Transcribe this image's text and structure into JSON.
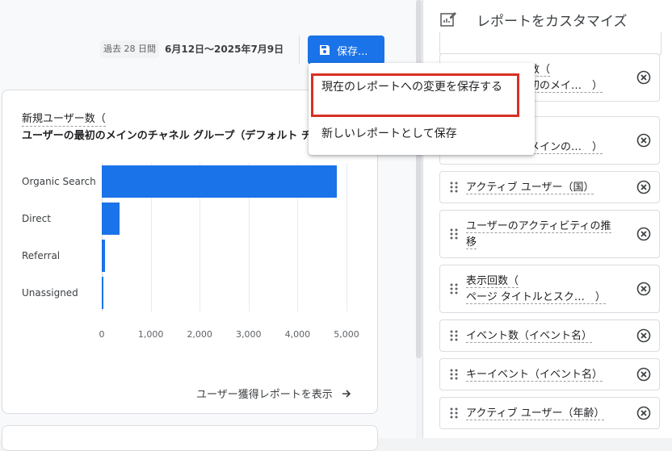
{
  "header": {
    "date_range_label": "過去 28 日間",
    "date_range_value": "6月12日〜2025年7月9日",
    "save_button_label": "保存..."
  },
  "save_menu": {
    "items": [
      {
        "label": "現在のレポートへの変更を保存する"
      },
      {
        "label": "新しいレポートとして保存"
      }
    ]
  },
  "card": {
    "title_line1": "新規ユーザー数（",
    "title_line2": "ユーザーの最初のメインのチャネル グループ（デフォルト チャネル グループ））",
    "view_link": "ユーザー獲得レポートを表示"
  },
  "chart_data": {
    "type": "bar",
    "orientation": "horizontal",
    "categories": [
      "Organic Search",
      "Direct",
      "Referral",
      "Unassigned"
    ],
    "values": [
      4800,
      370,
      70,
      20
    ],
    "xlim": [
      0,
      5000
    ],
    "ticks": [
      "0",
      "1,000",
      "2,000",
      "3,000",
      "4,000",
      "5,000"
    ],
    "color": "#1a73e8"
  },
  "panel": {
    "title": "レポートをカスタマイズ",
    "items": [
      {
        "line1": "数（",
        "line2": "初のメイ…　）"
      },
      {
        "line1": "",
        "line2": "メインの…　）"
      },
      {
        "line1": "アクティブ ユーザー（国）",
        "line2": ""
      },
      {
        "line1": "ユーザーのアクティビティの推",
        "line2": "移"
      },
      {
        "line1": "表示回数（",
        "line2": "ページ タイトルとスク…　）"
      },
      {
        "line1": "イベント数（イベント名）",
        "line2": ""
      },
      {
        "line1": "キーイベント（イベント名）",
        "line2": ""
      },
      {
        "line1": "アクティブ ユーザー（年齢）",
        "line2": ""
      }
    ]
  },
  "colors": {
    "accent": "#1a73e8",
    "highlight_border": "#d93025"
  }
}
